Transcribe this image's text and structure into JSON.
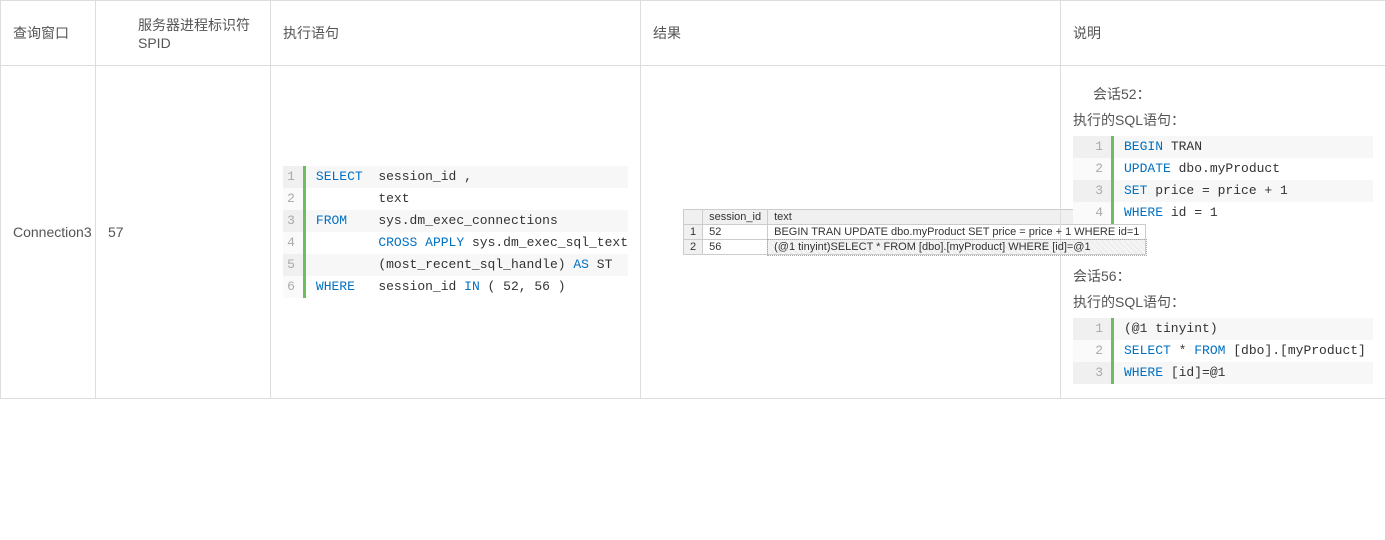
{
  "headers": {
    "col1": "查询窗口",
    "col2": "服务器进程标识符SPID",
    "col3": "执行语句",
    "col4": "结果",
    "col5": "说明"
  },
  "row": {
    "window": "Connection3",
    "spid": "57"
  },
  "exec_sql": [
    {
      "ln": "1",
      "tokens": [
        [
          "kw",
          "SELECT"
        ],
        [
          "",
          "  session_id ,"
        ]
      ]
    },
    {
      "ln": "2",
      "tokens": [
        [
          "",
          "        text"
        ]
      ]
    },
    {
      "ln": "3",
      "tokens": [
        [
          "kw",
          "FROM"
        ],
        [
          "",
          "    sys.dm_exec_connections"
        ]
      ]
    },
    {
      "ln": "4",
      "tokens": [
        [
          "",
          "        "
        ],
        [
          "kw",
          "CROSS"
        ],
        [
          "",
          " "
        ],
        [
          "kw",
          "APPLY"
        ],
        [
          "",
          " sys.dm_exec_sql_text"
        ]
      ]
    },
    {
      "ln": "5",
      "tokens": [
        [
          "",
          "        (most_recent_sql_handle) "
        ],
        [
          "kw",
          "AS"
        ],
        [
          "",
          " ST"
        ]
      ]
    },
    {
      "ln": "6",
      "tokens": [
        [
          "kw",
          "WHERE"
        ],
        [
          "",
          "   session_id "
        ],
        [
          "kw",
          "IN"
        ],
        [
          "",
          " ( 52, 56 )"
        ]
      ]
    }
  ],
  "result_grid": {
    "columns": [
      "session_id",
      "text"
    ],
    "rows": [
      {
        "n": "1",
        "session_id": "52",
        "text": "BEGIN TRAN  UPDATE dbo.myProduct SET price = price + 1 WHERE id=1",
        "sel": false
      },
      {
        "n": "2",
        "session_id": "56",
        "text": "(@1 tinyint)SELECT * FROM [dbo].[myProduct] WHERE [id]=@1",
        "sel": true
      }
    ]
  },
  "explain": {
    "s52_title": "会话52：",
    "s52_sub": "执行的SQL语句：",
    "s52_sql": [
      {
        "ln": "1",
        "tokens": [
          [
            "kw",
            "BEGIN"
          ],
          [
            "",
            " TRAN"
          ]
        ]
      },
      {
        "ln": "2",
        "tokens": [
          [
            "kw",
            "UPDATE"
          ],
          [
            "",
            " dbo.myProduct"
          ]
        ]
      },
      {
        "ln": "3",
        "tokens": [
          [
            "kw",
            "SET"
          ],
          [
            "",
            " price = price + 1"
          ]
        ]
      },
      {
        "ln": "4",
        "tokens": [
          [
            "kw",
            "WHERE"
          ],
          [
            "",
            " id = 1"
          ]
        ]
      }
    ],
    "s56_title": "会话56：",
    "s56_sub": "执行的SQL语句：",
    "s56_sql": [
      {
        "ln": "1",
        "tokens": [
          [
            "",
            "(@1 tinyint)"
          ]
        ]
      },
      {
        "ln": "2",
        "tokens": [
          [
            "kw",
            "SELECT"
          ],
          [
            "",
            " * "
          ],
          [
            "kw",
            "FROM"
          ],
          [
            "",
            " [dbo].[myProduct]"
          ]
        ]
      },
      {
        "ln": "3",
        "tokens": [
          [
            "kw",
            "WHERE"
          ],
          [
            "",
            " [id]=@1"
          ]
        ]
      }
    ]
  }
}
